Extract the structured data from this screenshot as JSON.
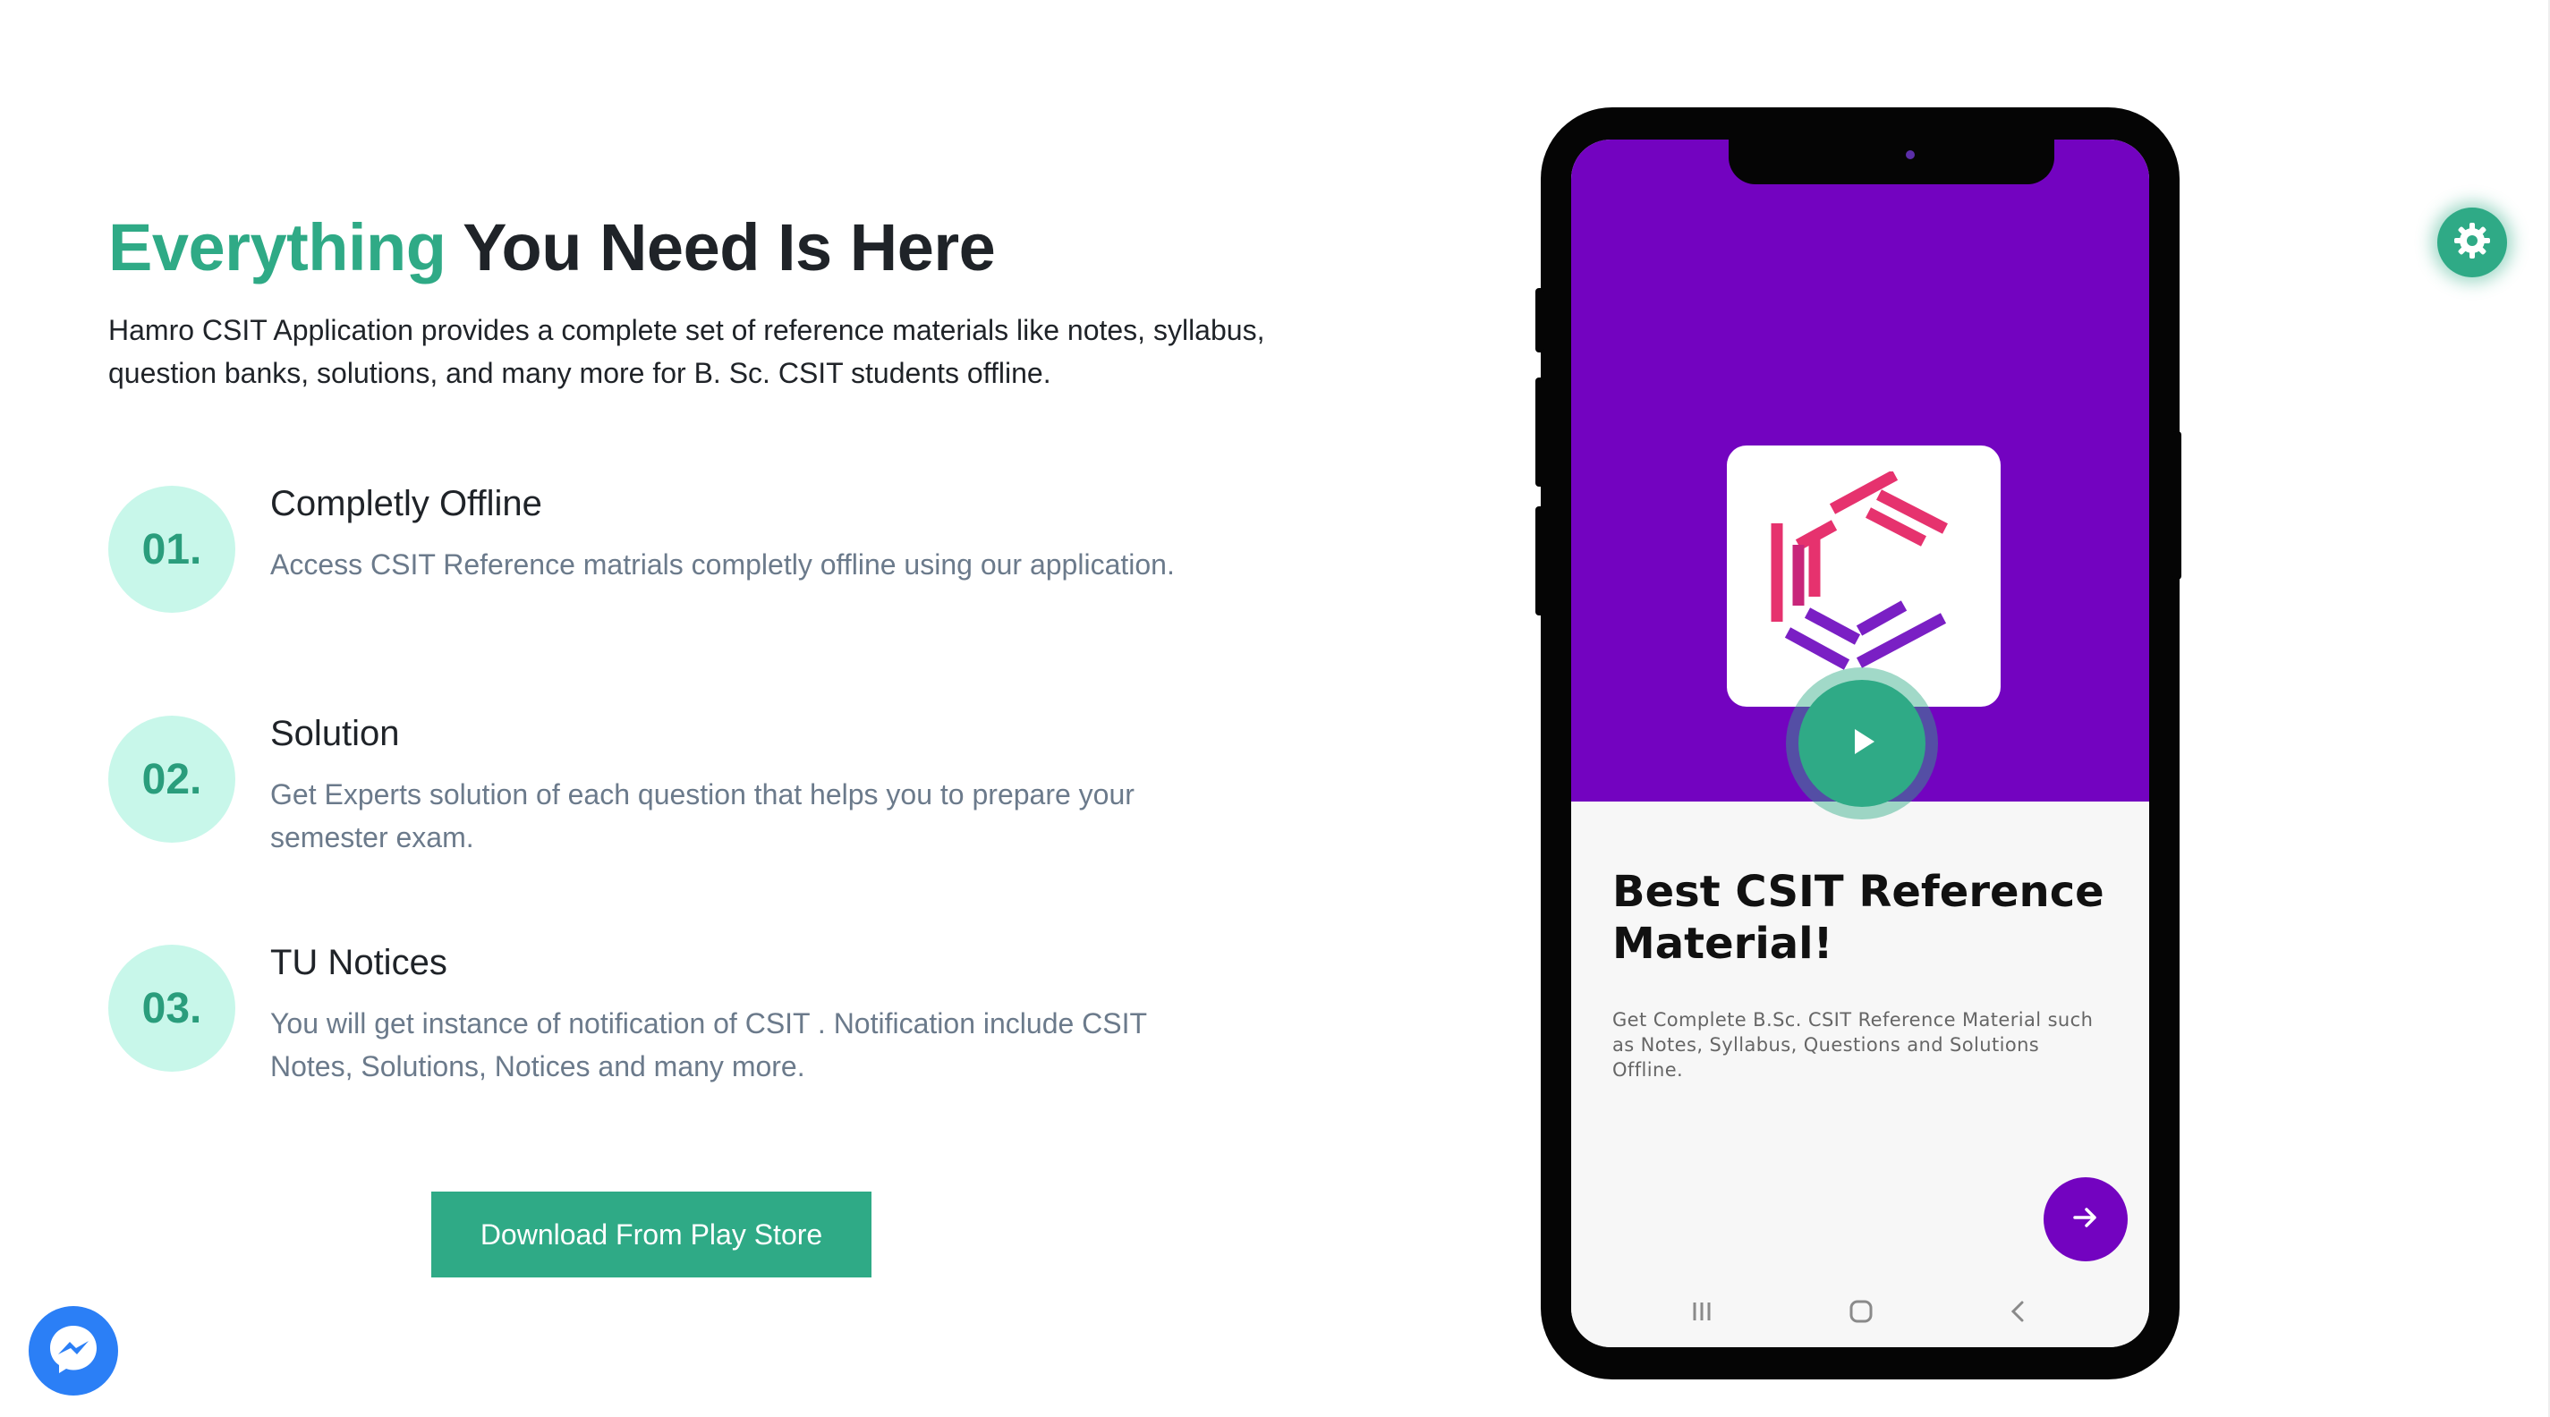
{
  "hero": {
    "heading_accent": "Everything",
    "heading_rest": " You Need Is Here",
    "intro": "Hamro CSIT Application provides a complete set of reference materials like notes, syllabus, question banks, solutions, and many more for B. Sc. CSIT students offline."
  },
  "features": [
    {
      "number": "01.",
      "title": "Completly Offline",
      "description": "Access CSIT Reference matrials completly offline using our application."
    },
    {
      "number": "02.",
      "title": "Solution",
      "description": "Get Experts solution of each question that helps you to prepare your semester exam."
    },
    {
      "number": "03.",
      "title": "TU Notices",
      "description": "You will get instance of notification of CSIT . Notification include CSIT Notes, Solutions, Notices and many more."
    }
  ],
  "download_button": {
    "label": "Download From Play Store"
  },
  "phone": {
    "card_title": "Best CSIT Reference Material!",
    "card_description": "Get Complete B.Sc. CSIT Reference Material such as Notes, Syllabus, Questions and Solutions Offline.",
    "icons": {
      "app_logo": "csit-logo-icon",
      "play": "play-icon",
      "next": "arrow-right-icon",
      "nav": [
        "recent-apps-icon",
        "home-icon",
        "back-icon"
      ]
    }
  },
  "floating": {
    "settings_icon": "gear-icon",
    "chat_icon": "messenger-icon"
  },
  "colors": {
    "accent": "#2faa86",
    "badge_bg": "#c8f7ea",
    "phone_purple": "#7303c0",
    "text_dark": "#1f2328",
    "text_muted": "#6b7a8b",
    "messenger_blue": "#2b7ff6"
  }
}
